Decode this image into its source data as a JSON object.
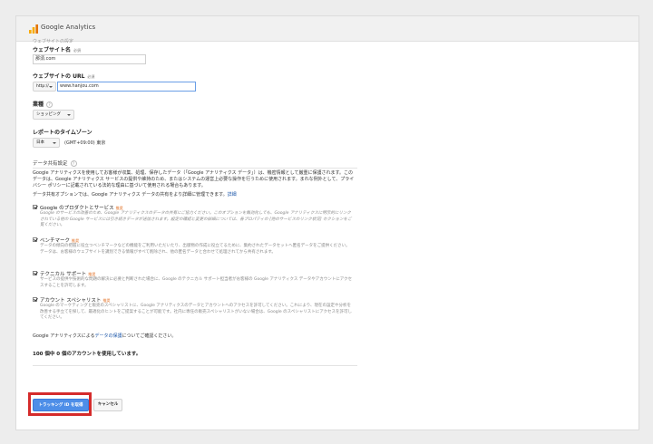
{
  "header": {
    "logo_text": "Google Analytics"
  },
  "form": {
    "cut_label": "ウェブサイトの設定",
    "website_name": {
      "label": "ウェブサイト名",
      "required": "必須",
      "value": "那須.com"
    },
    "website_url": {
      "label": "ウェブサイトの URL",
      "required": "必須",
      "protocol": "http://",
      "value": "www.hanjou.com"
    },
    "industry": {
      "label": "業種",
      "help": "?",
      "value": "ショッピング"
    },
    "timezone": {
      "label": "レポートのタイムゾーン",
      "country": "日本",
      "zone": "(GMT+09:00) 東京"
    }
  },
  "sharing": {
    "title": "データ共有設定",
    "help": "?",
    "intro": "Google アナリティクスを使用してお客様が収集、処理、保存したデータ（「Google アナリティクス データ」）は、機密情報として厳重に保護されます。このデータは、Google アナリティクス サービスの提供や維持のため、またはシステムの運営上必要な操作を行うために使用されます。まれな例外として、プライバシー ポリシーに記載されている法的な理由に基づいて使用される場合もあります。",
    "manage_prefix": "データ共有オプションでは、Google アナリティクス データの共有をより詳細に管理できます。",
    "manage_link": "詳細",
    "options": [
      {
        "title": "Google のプロダクトとサービス",
        "tag": "推奨",
        "checked": true,
        "desc": "Google のサービスの改善のため、Google アナリティクスのデータの共有にご協力ください。このオプションを無効化しても、Google アナリティクスに明示的にリンクされている他の Google サービスには引き続きデータが送信されます。設定の確認と変更の詳細については、各プロパティの [他のサービスのリンク状況] セクションをご覧ください。"
      },
      {
        "title": "ベンチマーク",
        "tag": "推奨",
        "checked": true,
        "desc": "データの傾向の把握に役立つベンチマークなどの機能をご利用いただいたり、出版物の作成に役立てるために、集約されたデータセットへ匿名データをご提供ください。データは、お客様のウェブサイトを識別できる情報がすべて削除され、他の匿名データと合わせて処理されてから共有されます。"
      },
      {
        "title": "テクニカル サポート",
        "tag": "推奨",
        "checked": true,
        "desc": "サービスの提供や技術的な問題の解決に必要と判断された場合に、Google のテクニカル サポート担当者がお客様の Google アナリティクス データやアカウントにアクセスすることを許可します。"
      },
      {
        "title": "アカウント スペシャリスト",
        "tag": "推奨",
        "checked": true,
        "desc": "Google のマーケティングと販売のスペシャリストに、Google アナリティクスのデータとアカウントへのアクセスを許可してください。これにより、現在の設定や分析を改善する手立てを探して、最適化のヒントをご提案することが可能です。社内に専任の販売スペシャリストがいない場合は、Google のスペシャリストにアクセスを許可してください。"
      }
    ],
    "protection_prefix": "Google アナリティクスによる",
    "protection_link": "データの保護",
    "protection_suffix": "についてご確認ください。"
  },
  "accounts_used": "100 個中 0 個のアカウントを使用しています。",
  "buttons": {
    "get_tracking_id": "トラッキング ID を取得",
    "cancel": "キャンセル"
  },
  "colors": {
    "primary": "#4d8ee8",
    "highlight": "#d52b2b",
    "tag": "#e06a1b",
    "link": "#1a55a8"
  }
}
